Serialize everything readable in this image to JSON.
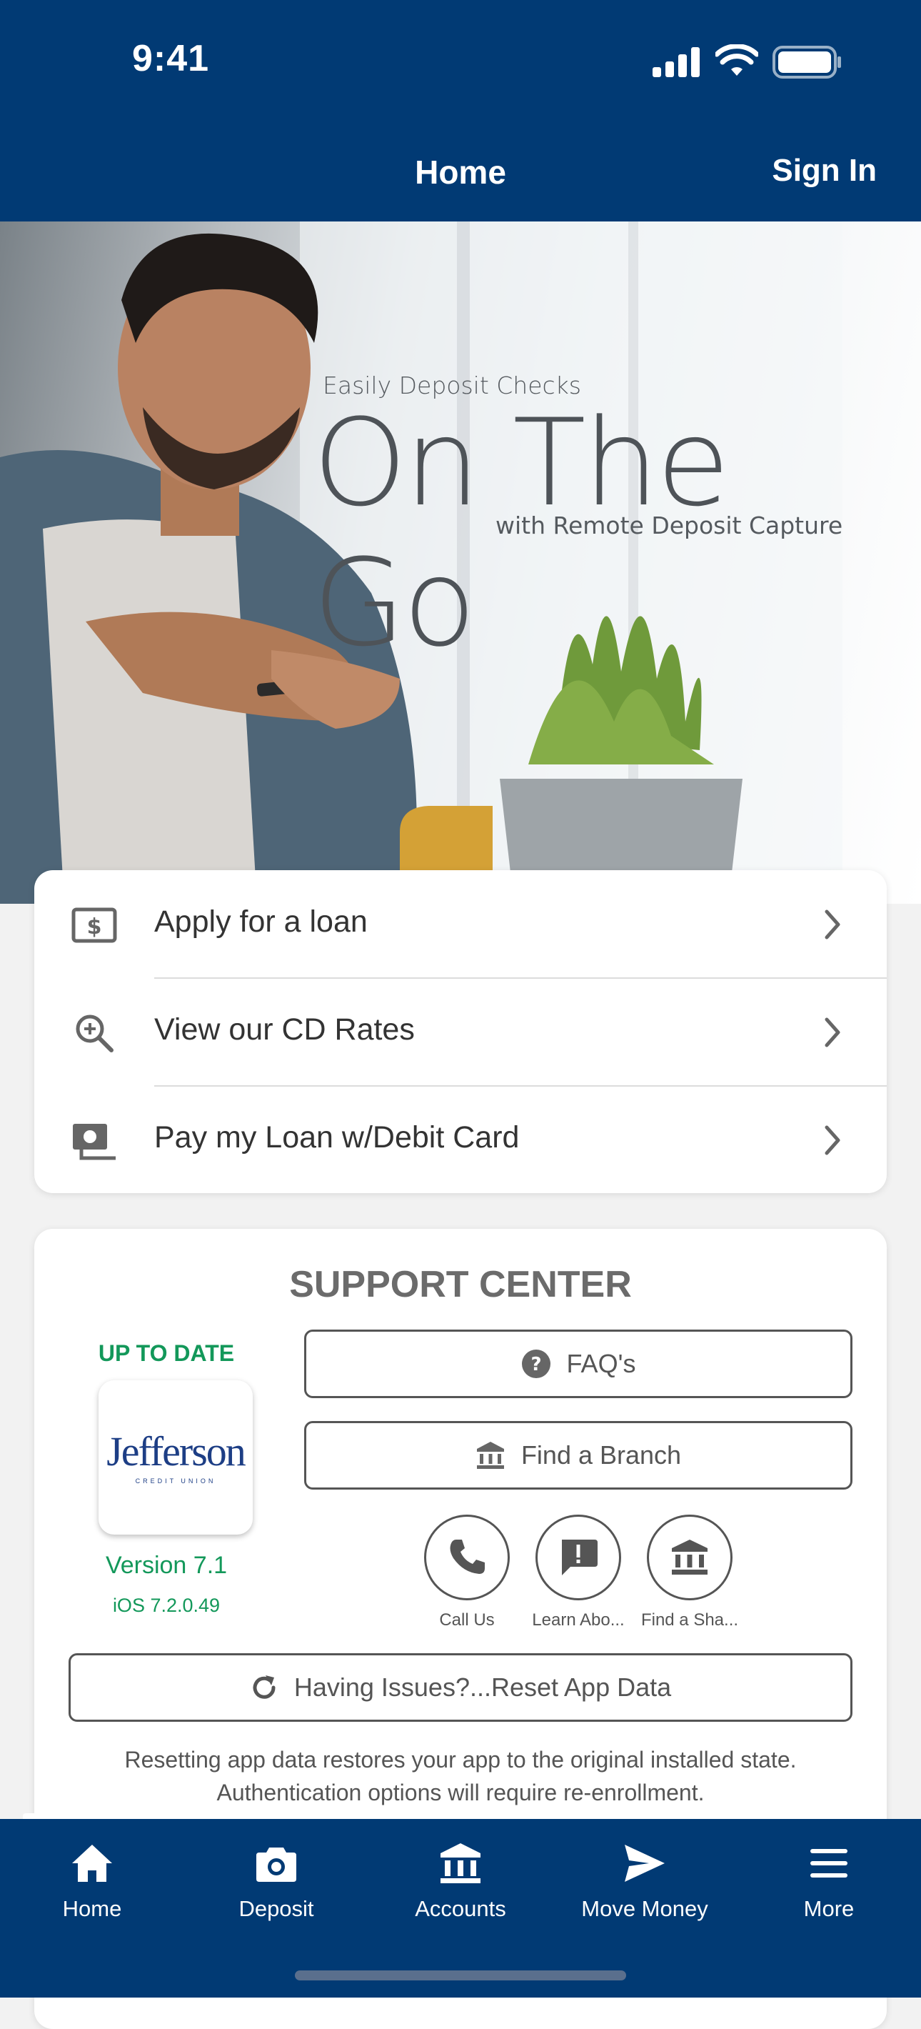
{
  "status_bar": {
    "time": "9:41"
  },
  "header": {
    "title": "Home",
    "sign_in": "Sign In"
  },
  "hero": {
    "pre_text": "Easily Deposit Checks",
    "headline": "On The Go",
    "post_text": "with Remote Deposit Capture"
  },
  "quick_links": [
    {
      "label": "Apply for a loan",
      "icon": "dollar-bill-icon"
    },
    {
      "label": "View our CD Rates",
      "icon": "zoom-in-icon"
    },
    {
      "label": "Pay my Loan w/Debit Card",
      "icon": "payment-icon"
    }
  ],
  "support": {
    "title": "SUPPORT CENTER",
    "status": "UP TO DATE",
    "logo_text": "Jefferson",
    "logo_subtext": "CREDIT UNION",
    "version": "Version 7.1",
    "ios_version": "iOS 7.2.0.49",
    "faq_label": "FAQ's",
    "branch_label": "Find a Branch",
    "circles": [
      {
        "label": "Call Us",
        "icon": "phone-icon"
      },
      {
        "label": "Learn Abo...",
        "icon": "alert-message-icon"
      },
      {
        "label": "Find a Sha...",
        "icon": "bank-icon"
      }
    ],
    "reset_label": "Having Issues?...Reset App Data",
    "reset_note_line1": "Resetting app data restores your app to the original installed state.",
    "reset_note_line2": "Authentication options will require re-enrollment."
  },
  "tabs": [
    {
      "label": "Home",
      "icon": "home-icon",
      "active": true
    },
    {
      "label": "Deposit",
      "icon": "camera-icon",
      "active": false
    },
    {
      "label": "Accounts",
      "icon": "bank-icon",
      "active": false
    },
    {
      "label": "Move Money",
      "icon": "send-icon",
      "active": false
    },
    {
      "label": "More",
      "icon": "menu-icon",
      "active": false
    }
  ],
  "colors": {
    "brand_navy": "#013a74",
    "status_green": "#13985a",
    "outline_gray": "#555555"
  }
}
